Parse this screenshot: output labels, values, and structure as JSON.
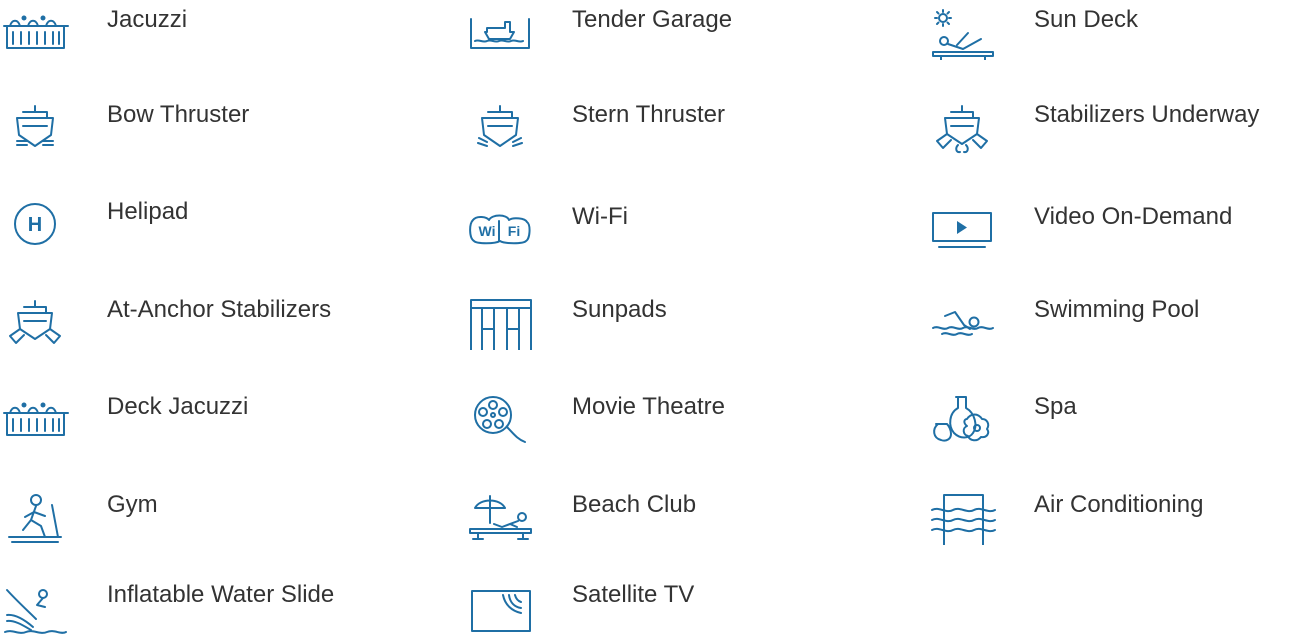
{
  "amenities": {
    "col1": [
      {
        "label": "Jacuzzi",
        "icon": "jacuzzi-icon"
      },
      {
        "label": "Bow Thruster",
        "icon": "bow-thruster-icon"
      },
      {
        "label": "Helipad",
        "icon": "helipad-icon"
      },
      {
        "label": "At-Anchor Stabilizers",
        "icon": "at-anchor-stabilizers-icon"
      },
      {
        "label": "Deck Jacuzzi",
        "icon": "deck-jacuzzi-icon"
      },
      {
        "label": "Gym",
        "icon": "gym-icon"
      },
      {
        "label": "Inflatable Water Slide",
        "icon": "water-slide-icon"
      }
    ],
    "col2": [
      {
        "label": "Tender Garage",
        "icon": "tender-garage-icon"
      },
      {
        "label": "Stern Thruster",
        "icon": "stern-thruster-icon"
      },
      {
        "label": "Wi-Fi",
        "icon": "wifi-icon"
      },
      {
        "label": "Sunpads",
        "icon": "sunpads-icon"
      },
      {
        "label": "Movie Theatre",
        "icon": "movie-reel-icon"
      },
      {
        "label": "Beach Club",
        "icon": "beach-club-icon"
      },
      {
        "label": "Satellite TV",
        "icon": "satellite-tv-icon"
      }
    ],
    "col3": [
      {
        "label": "Sun Deck",
        "icon": "sun-deck-icon"
      },
      {
        "label": "Stabilizers Underway",
        "icon": "stabilizers-underway-icon"
      },
      {
        "label": "Video On-Demand",
        "icon": "video-on-demand-icon"
      },
      {
        "label": "Swimming Pool",
        "icon": "swimming-pool-icon"
      },
      {
        "label": "Spa",
        "icon": "spa-icon"
      },
      {
        "label": "Air Conditioning",
        "icon": "air-conditioning-icon"
      }
    ]
  },
  "icon_text": {
    "helipad": "H",
    "wifi_left": "Wi",
    "wifi_right": "Fi"
  },
  "colors": {
    "icon": "#1f6fa5",
    "text": "#333333",
    "background": "#ffffff"
  }
}
